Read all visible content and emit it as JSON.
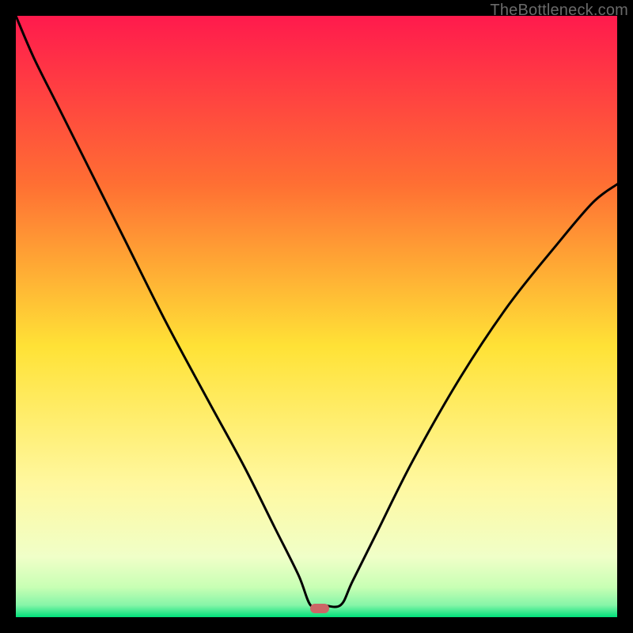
{
  "watermark": "TheBottleneck.com",
  "colors": {
    "frame": "#000000",
    "gradient_top": "#ff1a4d",
    "gradient_upper_mid": "#ff7a33",
    "gradient_mid": "#ffe236",
    "gradient_lower_mid": "#f7ffb3",
    "gradient_band": "#d2ffbe",
    "gradient_bottom": "#00e07a",
    "curve": "#000000",
    "marker": "#cc6666",
    "watermark": "#6a6a6a"
  },
  "chart_data": {
    "type": "line",
    "title": "",
    "xlabel": "",
    "ylabel": "",
    "xlim": [
      0,
      1
    ],
    "ylim": [
      0,
      1
    ],
    "description": "V-shaped bottleneck curve on a heatmap-style gradient background. Lower y = less bottleneck (green), higher y = more bottleneck (red). Minimum (optimal balance) near x ≈ 0.50.",
    "series": [
      {
        "name": "bottleneck-curve",
        "x": [
          0.0,
          0.03,
          0.07,
          0.12,
          0.18,
          0.25,
          0.32,
          0.38,
          0.43,
          0.47,
          0.49,
          0.51,
          0.54,
          0.56,
          0.6,
          0.66,
          0.74,
          0.82,
          0.9,
          0.96,
          1.0
        ],
        "values": [
          1.0,
          0.93,
          0.85,
          0.75,
          0.63,
          0.49,
          0.36,
          0.25,
          0.15,
          0.07,
          0.02,
          0.02,
          0.02,
          0.06,
          0.14,
          0.26,
          0.4,
          0.52,
          0.62,
          0.69,
          0.72
        ]
      }
    ],
    "marker": {
      "x": 0.505,
      "y": 0.015
    }
  }
}
